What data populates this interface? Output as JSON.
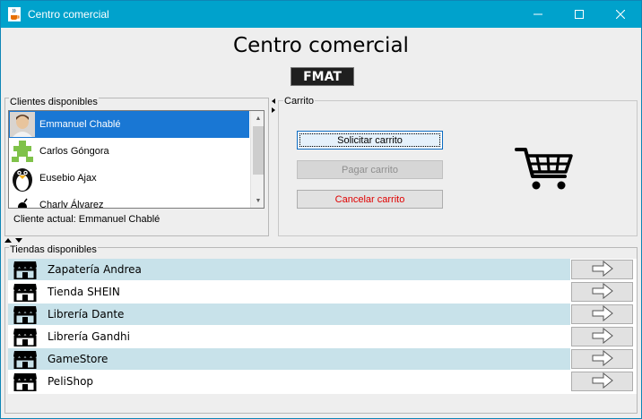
{
  "window": {
    "title": "Centro comercial",
    "accent": "#00a2cc"
  },
  "header": {
    "title": "Centro comercial",
    "logo_text": "FMAT"
  },
  "clients": {
    "group_label": "Clientes disponibles",
    "items": [
      {
        "name": "Emmanuel Chablé",
        "avatar": "photo-avatar",
        "selected": true
      },
      {
        "name": "Carlos Góngora",
        "avatar": "green-pixel-avatar",
        "selected": false
      },
      {
        "name": "Eusebio Ajax",
        "avatar": "penguin-avatar",
        "selected": false
      },
      {
        "name": "Charly Álvarez",
        "avatar": "bomb-avatar",
        "selected": false
      }
    ],
    "current_label": "Cliente actual: Emmanuel Chablé"
  },
  "cart": {
    "group_label": "Carrito",
    "request_label": "Solicitar carrito",
    "pay_label": "Pagar carrito",
    "cancel_label": "Cancelar carrito",
    "icon": "shopping-cart-icon",
    "cancel_color": "#e00000"
  },
  "stores": {
    "group_label": "Tiendas disponibles",
    "row_highlight": "#c8e2ea",
    "items": [
      {
        "name": "Zapatería Andrea",
        "icon": "store-icon"
      },
      {
        "name": "Tienda SHEIN",
        "icon": "store-icon"
      },
      {
        "name": "Librería Dante",
        "icon": "store-icon"
      },
      {
        "name": "Librería Gandhi",
        "icon": "store-icon"
      },
      {
        "name": "GameStore",
        "icon": "store-icon"
      },
      {
        "name": "PeliShop",
        "icon": "store-icon"
      }
    ]
  }
}
